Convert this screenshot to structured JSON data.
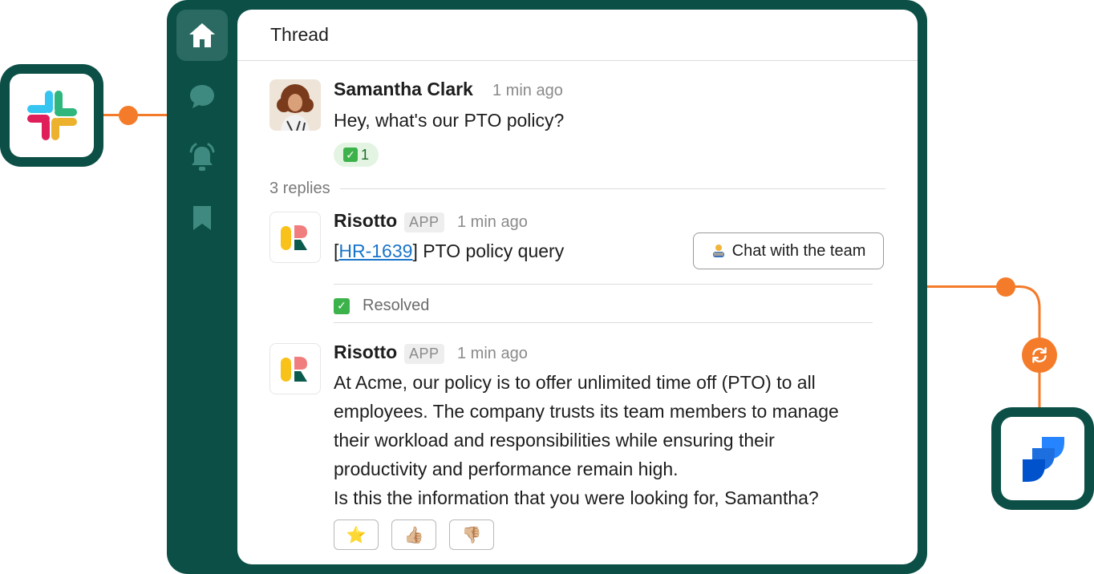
{
  "thread": {
    "title": "Thread"
  },
  "sidebar": {
    "items": [
      "home-icon",
      "chat-icon",
      "bell-icon",
      "bookmark-icon"
    ]
  },
  "messages": [
    {
      "author": "Samantha Clark",
      "time": "1 min ago",
      "text": "Hey, what's our PTO policy?",
      "reaction": {
        "emoji": "check-icon",
        "count": "1"
      }
    },
    {
      "author": "Risotto",
      "tag": "APP",
      "time": "1 min ago",
      "ticket": {
        "open": "[",
        "id": "HR-1639",
        "close": "]",
        "title": "PTO policy query"
      },
      "button": "Chat with the team",
      "status": "Resolved"
    },
    {
      "author": "Risotto",
      "tag": "APP",
      "time": "1 min ago",
      "lines": [
        "At Acme, our policy is to offer unlimited time off (PTO) to all",
        "employees. The company trusts its team members to manage",
        "their workload and responsibilities while ensuring their",
        "productivity and performance remain high.",
        "Is this the information that you were looking for, Samantha?"
      ],
      "feedback": [
        "⭐",
        "👍🏼",
        "👎🏼"
      ]
    }
  ],
  "replies": "3 replies",
  "colors": {
    "frame": "#0b4f46",
    "accent": "#f47b2a",
    "link": "#1a74c9"
  }
}
